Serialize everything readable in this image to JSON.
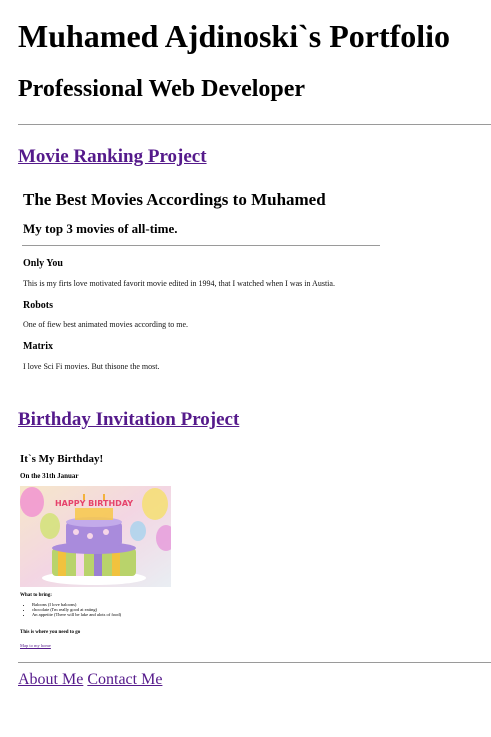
{
  "header": {
    "title": "Muhamed Ajdinoski`s Portfolio",
    "subtitle": "Professional Web Developer"
  },
  "projects": {
    "movie": {
      "link_label": "Movie Ranking Project",
      "heading": "The Best Movies Accordings to Muhamed",
      "subheading": "My top 3 movies of all-time.",
      "items": [
        {
          "title": "Only You",
          "desc": "This is my firts love motivated favorit movie edited in 1994, that I watched when I was in Austia."
        },
        {
          "title": "Robots",
          "desc": "One of fiew best animated movies according to me."
        },
        {
          "title": "Matrix",
          "desc": "I love Sci Fi movies. But thisone the most."
        }
      ]
    },
    "birthday": {
      "link_label": "Birthday Invitation Project",
      "heading": "It`s My Birthday!",
      "subheading": "On the 31th Januar",
      "image_text": "HAPPY BIRTHDAY",
      "bring_label": "What to bring:",
      "bring_items": [
        "Baloons (I love baloons)",
        "chocolate (I'm really good at eating)",
        "An appetite (There will be lake and alots of food)"
      ],
      "go_label": "This is where you need to go",
      "map_link": "Map to my home"
    }
  },
  "footer": {
    "about": "About Me",
    "contact": "Contact Me"
  },
  "colors": {
    "link": "#551a8b",
    "rule": "#9a9a9a"
  }
}
